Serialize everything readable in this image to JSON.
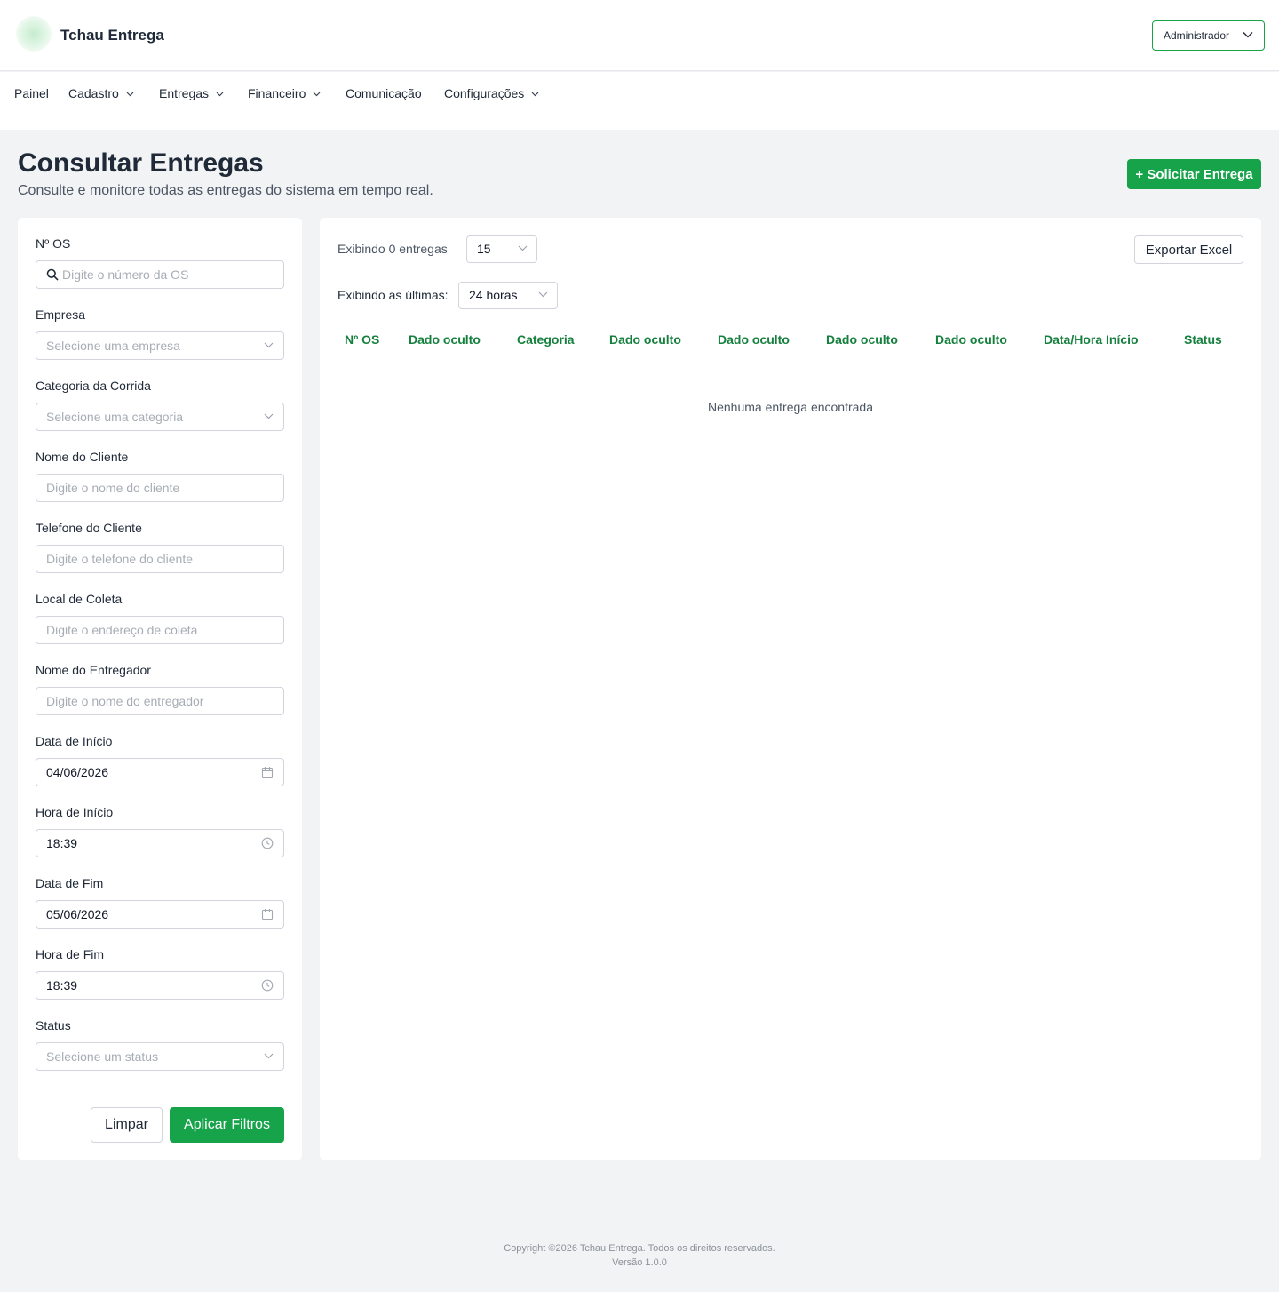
{
  "header": {
    "brand": "Tchau Entrega",
    "role_select": "Administrador"
  },
  "nav": {
    "items": [
      {
        "label": "Painel",
        "has_dropdown": false
      },
      {
        "label": "Cadastro",
        "has_dropdown": true
      },
      {
        "label": "Entregas",
        "has_dropdown": true
      },
      {
        "label": "Financeiro",
        "has_dropdown": true
      },
      {
        "label": "Comunicação",
        "has_dropdown": false
      },
      {
        "label": "Configurações",
        "has_dropdown": true
      }
    ]
  },
  "page": {
    "title": "Consultar Entregas",
    "subtitle": "Consulte e monitore todas as entregas do sistema em tempo real.",
    "request_button": "+ Solicitar Entrega"
  },
  "filters": {
    "os": {
      "label": "Nº OS",
      "placeholder": "Digite o número da OS",
      "icon": "search-icon"
    },
    "company": {
      "label": "Empresa",
      "placeholder": "Selecione uma empresa"
    },
    "category": {
      "label": "Categoria da Corrida",
      "placeholder": "Selecione uma categoria"
    },
    "client_name": {
      "label": "Nome do Cliente",
      "placeholder": "Digite o nome do cliente"
    },
    "client_phone": {
      "label": "Telefone do Cliente",
      "placeholder": "Digite o telefone do cliente"
    },
    "pickup": {
      "label": "Local de Coleta",
      "placeholder": "Digite o endereço de coleta"
    },
    "courier": {
      "label": "Nome do Entregador",
      "placeholder": "Digite o nome do entregador"
    },
    "start_date": {
      "label": "Data de Início",
      "value": "04/06/2026",
      "icon": "calendar-icon"
    },
    "start_time": {
      "label": "Hora de Início",
      "value": "18:39",
      "icon": "clock-icon"
    },
    "end_date": {
      "label": "Data de Fim",
      "value": "05/06/2026",
      "icon": "calendar-icon"
    },
    "end_time": {
      "label": "Hora de Fim",
      "value": "18:39",
      "icon": "clock-icon"
    },
    "status": {
      "label": "Status",
      "placeholder": "Selecione um status"
    },
    "clear_button": "Limpar",
    "apply_button": "Aplicar Filtros"
  },
  "results": {
    "count_label": "Exibindo 0 entregas",
    "page_size": "15",
    "range_label": "Exibindo as últimas:",
    "range_value": "24 horas",
    "export_button": "Exportar Excel",
    "columns": [
      "Nº OS",
      "Dado oculto",
      "Categoria",
      "Dado oculto",
      "Dado oculto",
      "Dado oculto",
      "Dado oculto",
      "Data/Hora Início",
      "Status"
    ],
    "empty_message": "Nenhuma entrega encontrada"
  },
  "footer": {
    "copyright": "Copyright ©2026 Tchau Entrega. Todos os direitos reservados.",
    "version": "Versão 1.0.0"
  },
  "colors": {
    "accent": "#16a34a",
    "table_header": "#15803d",
    "background": "#f2f3f5"
  }
}
